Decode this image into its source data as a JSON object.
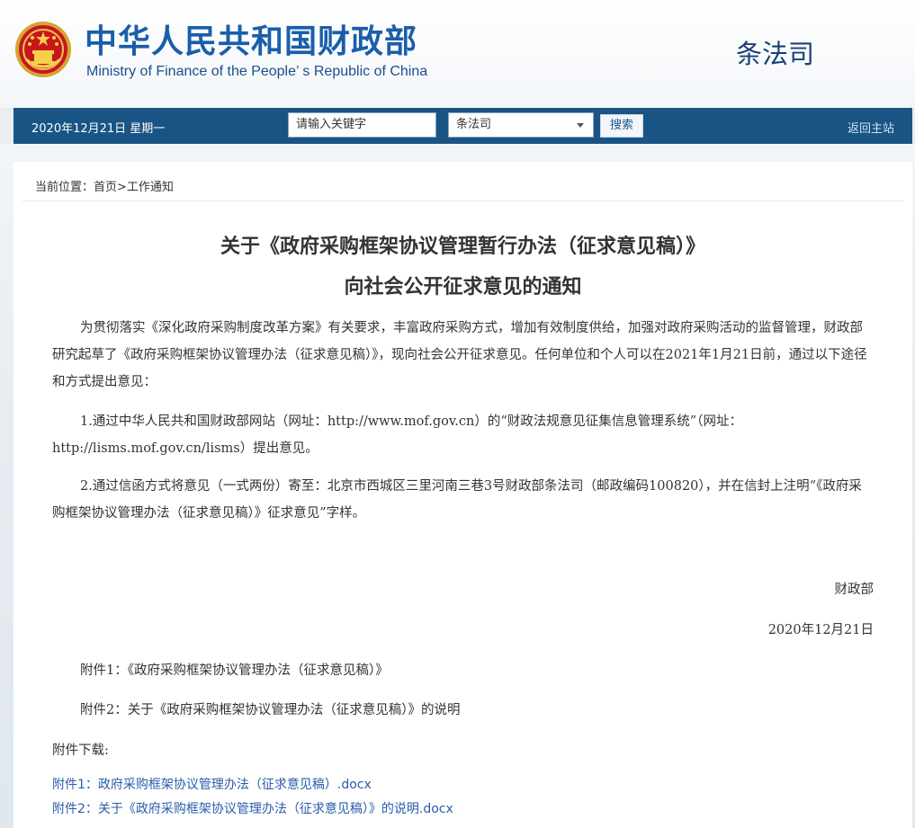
{
  "header": {
    "site_title": "中华人民共和国财政部",
    "site_title_en": "Ministry of Finance of the People’ s Republic of China",
    "dept_name": "条法司",
    "emblem_icon": "national-emblem-icon"
  },
  "nav": {
    "date": "2020年12月21日  星期一",
    "search_placeholder": "请输入关键字",
    "select_value": "条法司",
    "search_button": "搜索",
    "home_link": "返回主站",
    "bar_color": "#1a5485"
  },
  "breadcrumb": "当前位置：首页>工作通知",
  "article": {
    "title_line1": "关于《政府采购框架协议管理暂行办法（征求意见稿）》",
    "title_line2": "向社会公开征求意见的通知",
    "paragraph1": "为贯彻落实《深化政府采购制度改革方案》有关要求，丰富政府采购方式，增加有效制度供给，加强对政府采购活动的监督管理，财政部研究起草了《政府采购框架协议管理办法（征求意见稿）》，现向社会公开征求意见。任何单位和个人可以在2021年1月21日前，通过以下途径和方式提出意见：",
    "paragraph2": "1.通过中华人民共和国财政部网站（网址：http://www.mof.gov.cn）的“财政法规意见征集信息管理系统”（网址：http://lisms.mof.gov.cn/lisms）提出意见。",
    "paragraph3": "2.通过信函方式将意见（一式两份）寄至：北京市西城区三里河南三巷3号财政部条法司（邮政编码100820），并在信封上注明“《政府采购框架协议管理办法（征求意见稿）》征求意见”字样。",
    "signature_org": "财政部",
    "signature_date": "2020年12月21日",
    "attachment1": "附件1：《政府采购框架协议管理办法（征求意见稿）》",
    "attachment2": "附件2：关于《政府采购框架协议管理办法（征求意见稿）》的说明",
    "download_title": "附件下载:",
    "download1": "附件1：政府采购框架协议管理办法（征求意见稿）.docx",
    "download2": "附件2：关于《政府采购框架协议管理办法（征求意见稿）》的说明.docx"
  }
}
